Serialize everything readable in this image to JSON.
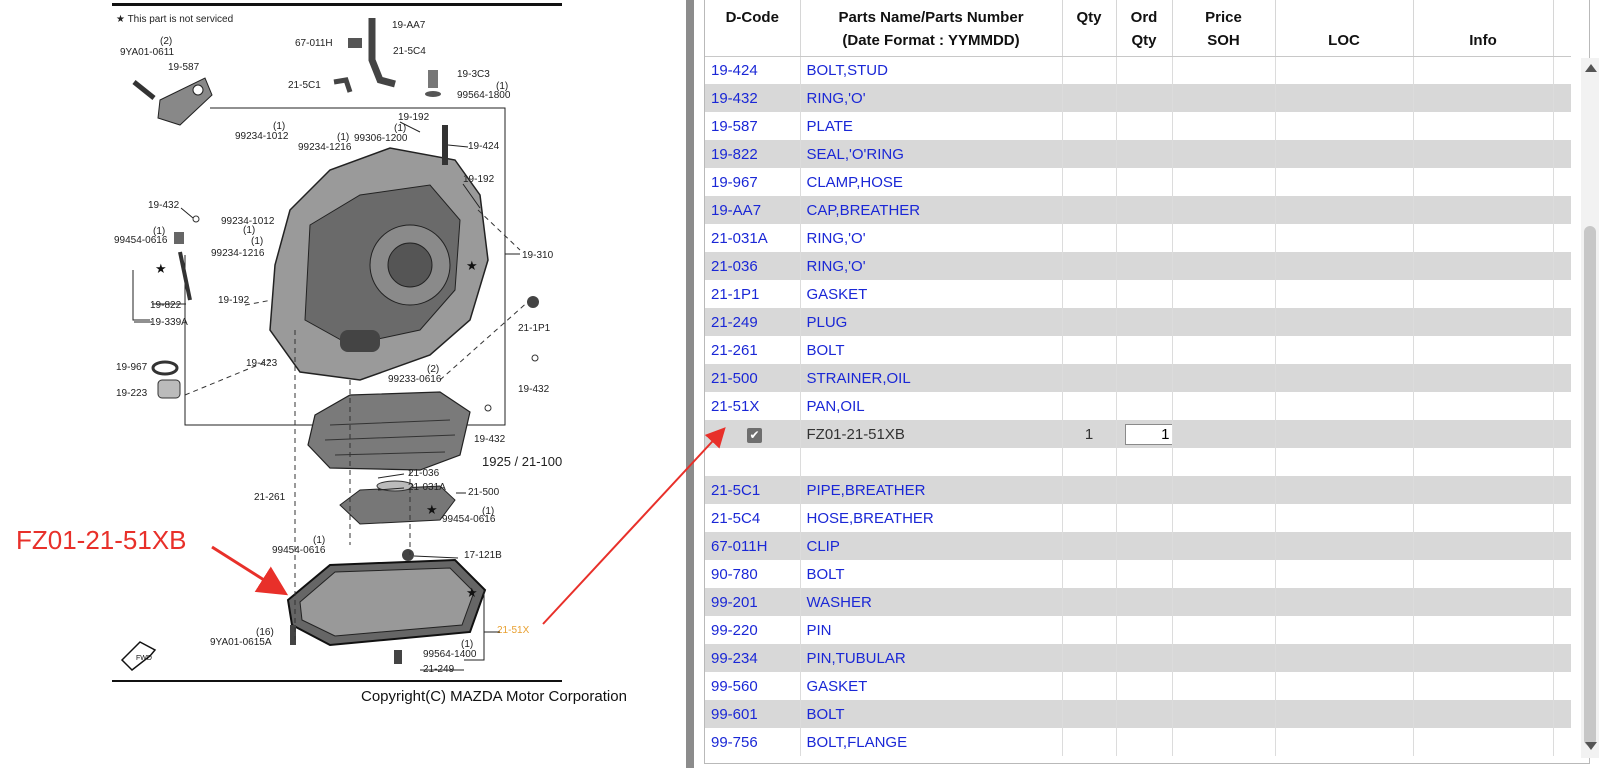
{
  "diagram": {
    "legend": "★ This part is not serviced",
    "copyright": "Copyright(C) MAZDA Motor Corporation",
    "callout_label": "FZ01-21-51XB",
    "callouts": [
      {
        "id": "9ya01-0611",
        "text": "9YA01-0611"
      },
      {
        "id": "qty2a",
        "text": "(2)"
      },
      {
        "id": "19-587",
        "text": "19-587"
      },
      {
        "id": "67-011h",
        "text": "67-011H"
      },
      {
        "id": "19-aa7",
        "text": "19-AA7"
      },
      {
        "id": "21-5c4",
        "text": "21-5C4"
      },
      {
        "id": "21-5c1",
        "text": "21-5C1"
      },
      {
        "id": "19-3c3",
        "text": "19-3C3"
      },
      {
        "id": "99564-1800",
        "text": "99564-1800"
      },
      {
        "id": "qty1a",
        "text": "(1)"
      },
      {
        "id": "99234-1012a",
        "text": "99234-1012"
      },
      {
        "id": "qty1b",
        "text": "(1)"
      },
      {
        "id": "99234-1216a",
        "text": "99234-1216"
      },
      {
        "id": "qty1c",
        "text": "(1)"
      },
      {
        "id": "99306-1200",
        "text": "99306-1200"
      },
      {
        "id": "qty1d",
        "text": "(1)"
      },
      {
        "id": "19-192a",
        "text": "19-192"
      },
      {
        "id": "19-424",
        "text": "19-424"
      },
      {
        "id": "19-192b",
        "text": "19-192"
      },
      {
        "id": "19-432a",
        "text": "19-432"
      },
      {
        "id": "99234-1012b",
        "text": "99234-1012"
      },
      {
        "id": "qty1e",
        "text": "(1)"
      },
      {
        "id": "99454-0616a",
        "text": "99454-0616"
      },
      {
        "id": "qty1f",
        "text": "(1)"
      },
      {
        "id": "99234-1216b",
        "text": "99234-1216"
      },
      {
        "id": "qty1g",
        "text": "(1)"
      },
      {
        "id": "19-310",
        "text": "19-310"
      },
      {
        "id": "19-822",
        "text": "19-822"
      },
      {
        "id": "19-339a",
        "text": "19-339A"
      },
      {
        "id": "19-192c",
        "text": "19-192"
      },
      {
        "id": "21-1p1",
        "text": "21-1P1"
      },
      {
        "id": "19-967",
        "text": "19-967"
      },
      {
        "id": "19-223",
        "text": "19-223"
      },
      {
        "id": "19-423",
        "text": "19-423"
      },
      {
        "id": "99233-0616",
        "text": "99233-0616"
      },
      {
        "id": "qty2b",
        "text": "(2)"
      },
      {
        "id": "19-432b",
        "text": "19-432"
      },
      {
        "id": "19-432c",
        "text": "19-432"
      },
      {
        "id": "1925-21-100",
        "text": "1925 / 21-100"
      },
      {
        "id": "21-036",
        "text": "21-036"
      },
      {
        "id": "21-031a",
        "text": "21-031A"
      },
      {
        "id": "21-500",
        "text": "21-500"
      },
      {
        "id": "21-261",
        "text": "21-261"
      },
      {
        "id": "99454-0616b",
        "text": "99454-0616"
      },
      {
        "id": "qty1h",
        "text": "(1)"
      },
      {
        "id": "99454-0616c",
        "text": "99454-0616"
      },
      {
        "id": "qty1i",
        "text": "(1)"
      },
      {
        "id": "17-121b",
        "text": "17-121B"
      },
      {
        "id": "21-51x",
        "text": "21-51X"
      },
      {
        "id": "9ya01-0615a",
        "text": "9YA01-0615A"
      },
      {
        "id": "qty16",
        "text": "(16)"
      },
      {
        "id": "99564-1400",
        "text": "99564-1400"
      },
      {
        "id": "qty1j",
        "text": "(1)"
      },
      {
        "id": "21-249",
        "text": "21-249"
      },
      {
        "id": "fwd",
        "text": "FWD"
      }
    ]
  },
  "table": {
    "headers": {
      "dcode": "D-Code",
      "pname_line1": "Parts Name/Parts Number",
      "pname_line2": "(Date Format : YYMMDD)",
      "qty": "Qty",
      "ord_line1": "Ord",
      "ord_line2": "Qty",
      "price_line1": "Price",
      "price_line2": "SOH",
      "loc": "LOC",
      "info": "Info"
    },
    "rows": [
      {
        "code": "19-424",
        "name": "BOLT,STUD"
      },
      {
        "code": "19-432",
        "name": "RING,'O'"
      },
      {
        "code": "19-587",
        "name": "PLATE"
      },
      {
        "code": "19-822",
        "name": "SEAL,'O'RING"
      },
      {
        "code": "19-967",
        "name": "CLAMP,HOSE"
      },
      {
        "code": "19-AA7",
        "name": "CAP,BREATHER"
      },
      {
        "code": "21-031A",
        "name": "RING,'O'"
      },
      {
        "code": "21-036",
        "name": "RING,'O'"
      },
      {
        "code": "21-1P1",
        "name": "GASKET"
      },
      {
        "code": "21-249",
        "name": "PLUG"
      },
      {
        "code": "21-261",
        "name": "BOLT"
      },
      {
        "code": "21-500",
        "name": "STRAINER,OIL"
      },
      {
        "code": "21-51X",
        "name": "PAN,OIL"
      },
      {
        "type": "part",
        "part_number": "FZ01-21-51XB",
        "qty": "1",
        "ord_qty": "1",
        "checked": true
      },
      {
        "type": "blank"
      },
      {
        "code": "21-5C1",
        "name": "PIPE,BREATHER"
      },
      {
        "code": "21-5C4",
        "name": "HOSE,BREATHER"
      },
      {
        "code": "67-011H",
        "name": "CLIP"
      },
      {
        "code": "90-780",
        "name": "BOLT"
      },
      {
        "code": "99-201",
        "name": "WASHER"
      },
      {
        "code": "99-220",
        "name": "PIN"
      },
      {
        "code": "99-234",
        "name": "PIN,TUBULAR"
      },
      {
        "code": "99-560",
        "name": "GASKET"
      },
      {
        "code": "99-601",
        "name": "BOLT"
      },
      {
        "code": "99-756",
        "name": "BOLT,FLANGE"
      }
    ]
  },
  "colors": {
    "link_blue": "#1a27d6",
    "callout_red": "#e8302a",
    "row_alt": "#d8d8d8",
    "highlight_orange": "#e8a030"
  }
}
